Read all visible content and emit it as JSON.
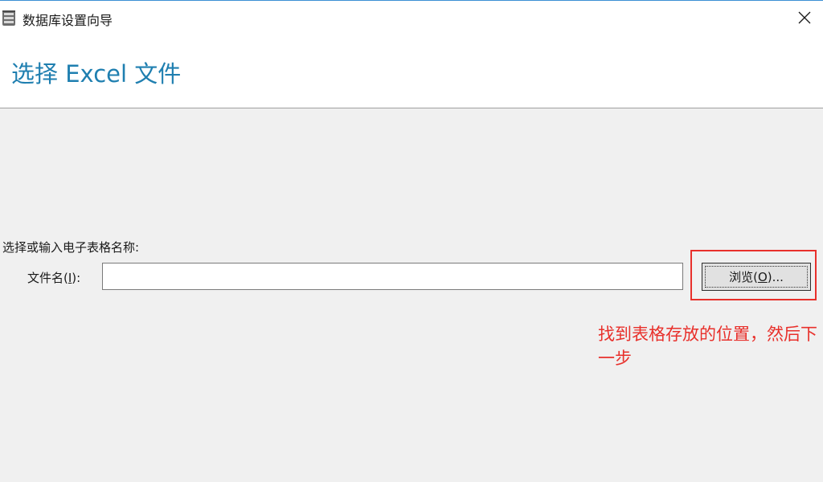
{
  "window": {
    "title": "数据库设置向导"
  },
  "header": {
    "title": "选择 Excel 文件"
  },
  "form": {
    "section_label": "选择或输入电子表格名称:",
    "file_label_prefix": "文件名(",
    "file_label_accel": "I",
    "file_label_suffix": "):",
    "file_value": "",
    "browse_prefix": "浏览(",
    "browse_accel": "O",
    "browse_suffix": ")..."
  },
  "annotation": {
    "text": "找到表格存放的位置，然后下一步",
    "color": "#e8302b"
  },
  "colors": {
    "title_blue": "#1f7fb0",
    "highlight_red": "#e8302b"
  },
  "icons": {
    "app": "database-icon",
    "close": "close-icon"
  }
}
